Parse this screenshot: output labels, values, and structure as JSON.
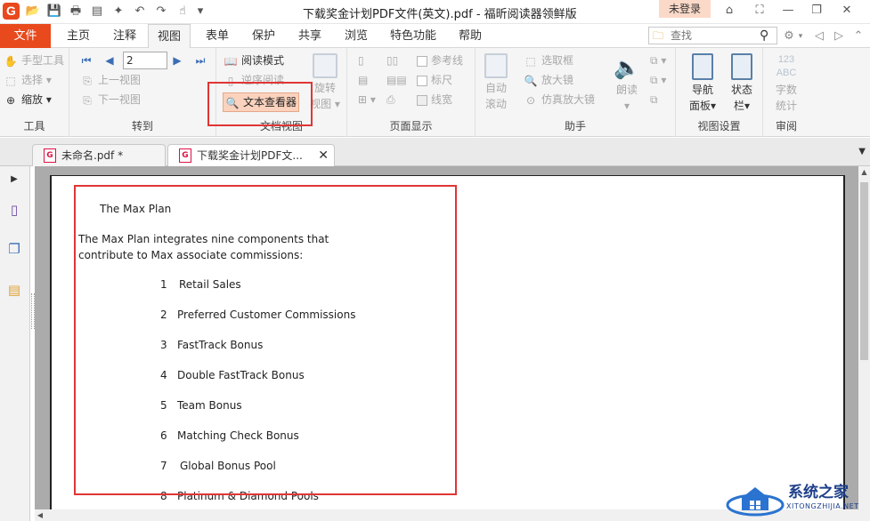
{
  "app": {
    "title": "下载奖金计划PDF文件(英文).pdf - 福昕阅读器领鲜版",
    "logo": "G",
    "login": "未登录"
  },
  "tabs": {
    "file": "文件",
    "items": [
      "主页",
      "注释",
      "视图",
      "表单",
      "保护",
      "共享",
      "浏览",
      "特色功能",
      "帮助"
    ],
    "active": "视图"
  },
  "search": {
    "placeholder": "查找"
  },
  "ribbon": {
    "tools": {
      "hand": "手型工具",
      "select": "选择",
      "zoom": "缩放",
      "label": "工具"
    },
    "goto": {
      "page_value": "2",
      "prev": "上一视图",
      "next": "下一视图",
      "label": "转到"
    },
    "docview": {
      "read_mode": "阅读模式",
      "reverse_read": "逆序阅读",
      "rotate_line1": "旋转",
      "rotate_line2": "视图",
      "text_viewer": "文本查看器",
      "label": "文档视图"
    },
    "pagedisplay": {
      "ruler_ref": "参考线",
      "ruler": "标尺",
      "linewidth": "线宽",
      "label": "页面显示"
    },
    "assistant": {
      "auto_scroll_1": "自动",
      "auto_scroll_2": "滚动",
      "marquee": "选取框",
      "magnifier": "放大镜",
      "loupe": "仿真放大镜",
      "read_aloud": "朗读",
      "label": "助手"
    },
    "viewsettings": {
      "nav_1": "导航",
      "nav_2": "面板",
      "status_1": "状态",
      "status_2": "栏",
      "label": "视图设置"
    },
    "review": {
      "wordcount_1": "字数",
      "wordcount_2": "统计",
      "icon_text_top": "123",
      "icon_text_bottom": "ABC",
      "label": "审阅"
    }
  },
  "doc_tabs": [
    {
      "label": "未命名.pdf *"
    },
    {
      "label": "下载奖金计划PDF文..."
    }
  ],
  "document": {
    "heading": "The  Max Plan",
    "intro_1": "The Max Plan integrates nine components that",
    "intro_2": "contribute to Max associate commissions:",
    "items": [
      {
        "num": "1",
        "text": "Retail Sales"
      },
      {
        "num": "2",
        "text": "Preferred Customer Commissions"
      },
      {
        "num": "3",
        "text": "FastTrack Bonus"
      },
      {
        "num": "4",
        "text": "Double FastTrack Bonus"
      },
      {
        "num": "5",
        "text": "Team Bonus"
      },
      {
        "num": "6",
        "text": "Matching Check Bonus"
      },
      {
        "num": "7",
        "text": "Global Bonus Pool"
      },
      {
        "num": "8",
        "text": "Platinum & Diamond Pools"
      }
    ]
  },
  "watermark": {
    "cn": "系统之家",
    "en": "XITONGZHIJIA.NET"
  },
  "colors": {
    "accent": "#e8491d",
    "highlight": "#fbd2bd",
    "frame": "#e03535"
  }
}
